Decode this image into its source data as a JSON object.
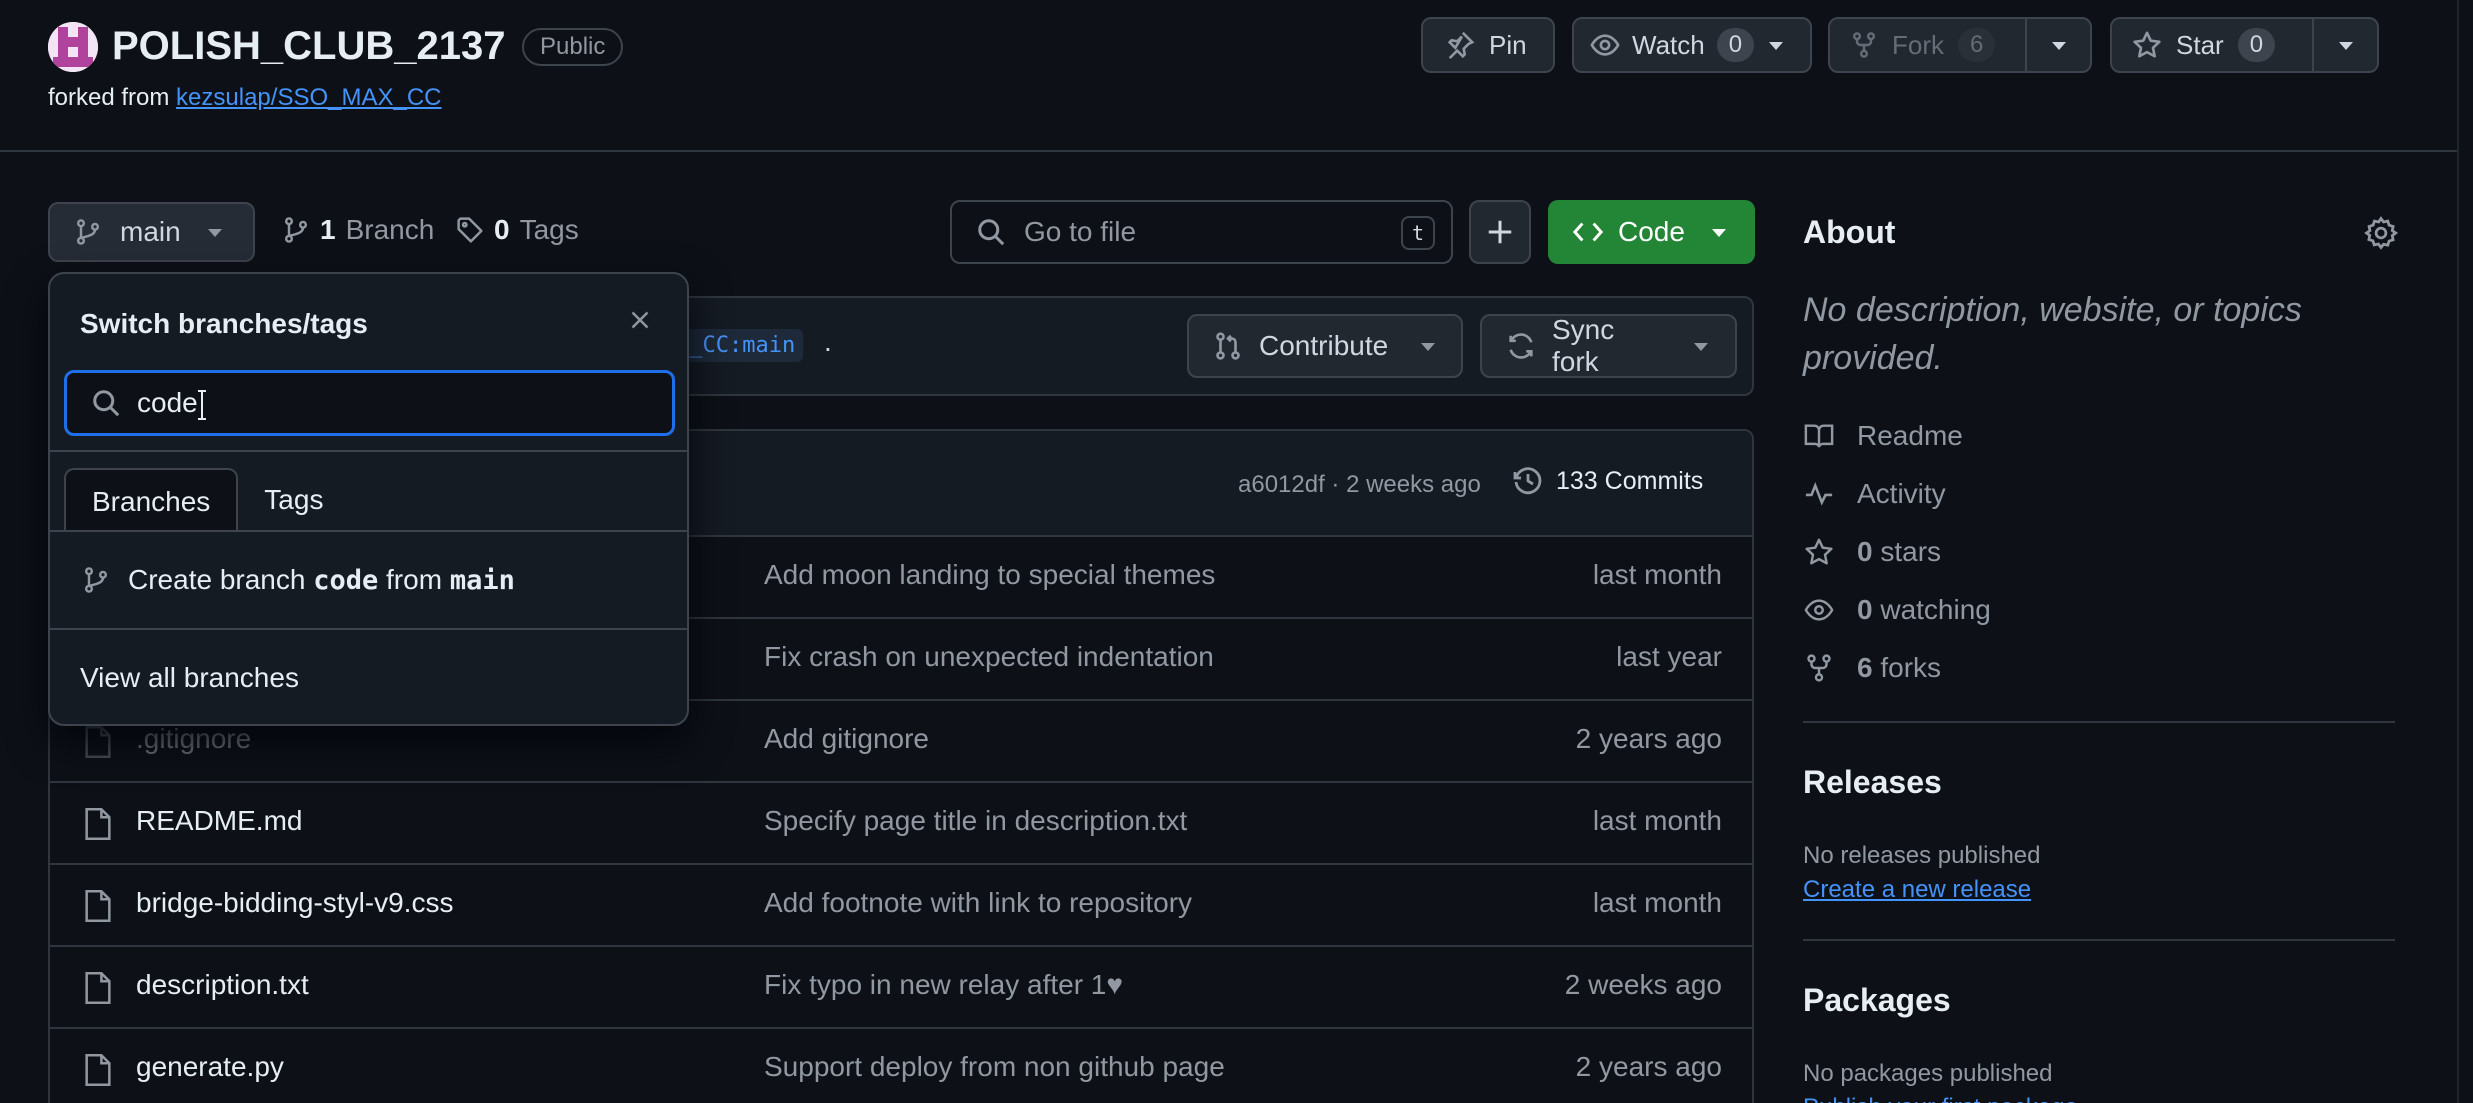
{
  "repo": {
    "name": "POLISH_CLUB_2137",
    "visibility": "Public",
    "forked_prefix": "forked from ",
    "forked_from": "kezsulap/SSO_MAX_CC"
  },
  "header_buttons": {
    "pin": "Pin",
    "watch": "Watch",
    "watch_count": "0",
    "fork": "Fork",
    "fork_count": "6",
    "star": "Star",
    "star_count": "0"
  },
  "toolbar": {
    "branch": "main",
    "branches_count": "1",
    "branches_label": "Branch",
    "tags_count": "0",
    "tags_label": "Tags",
    "goto_placeholder": "Go to file",
    "goto_shortcut": "t",
    "code_label": "Code"
  },
  "banner": {
    "ref_fragment": "X_CC:main",
    "suffix": ".",
    "contribute": "Contribute",
    "sync": "Sync fork"
  },
  "latest_commit": {
    "summary": "a6012df · 2 weeks ago",
    "commits": "133 Commits"
  },
  "files": [
    {
      "name": "",
      "message": "Add moon landing to special themes",
      "date": "last month"
    },
    {
      "name": "",
      "message": "Fix crash on unexpected indentation",
      "date": "last year"
    },
    {
      "name": ".gitignore",
      "message": "Add gitignore",
      "date": "2 years ago"
    },
    {
      "name": "README.md",
      "message": "Specify page title in description.txt",
      "date": "last month"
    },
    {
      "name": "bridge-bidding-styl-v9.css",
      "message": "Add footnote with link to repository",
      "date": "last month"
    },
    {
      "name": "description.txt",
      "message": "Fix typo in new relay after 1♥",
      "date": "2 weeks ago"
    },
    {
      "name": "generate.py",
      "message": "Support deploy from non github page",
      "date": "2 years ago"
    }
  ],
  "dropdown": {
    "title": "Switch branches/tags",
    "search_value": "code",
    "tab_branches": "Branches",
    "tab_tags": "Tags",
    "create_prefix": "Create branch",
    "create_name": "code",
    "create_mid": "from",
    "create_source": "main",
    "view_all": "View all branches"
  },
  "sidebar": {
    "about_title": "About",
    "about_desc": "No description, website, or topics provided.",
    "readme": "Readme",
    "activity": "Activity",
    "stars_count": "0",
    "stars_label": "stars",
    "watching_count": "0",
    "watching_label": "watching",
    "forks_count": "6",
    "forks_label": "forks",
    "releases_title": "Releases",
    "releases_text": "No releases published",
    "releases_link": "Create a new release",
    "packages_title": "Packages",
    "packages_text": "No packages published",
    "packages_link": "Publish your first package"
  },
  "colors": {
    "background": "#0d1117",
    "accent_green": "#238636",
    "link_blue": "#4493f8",
    "focus_blue": "#1f6feb"
  }
}
